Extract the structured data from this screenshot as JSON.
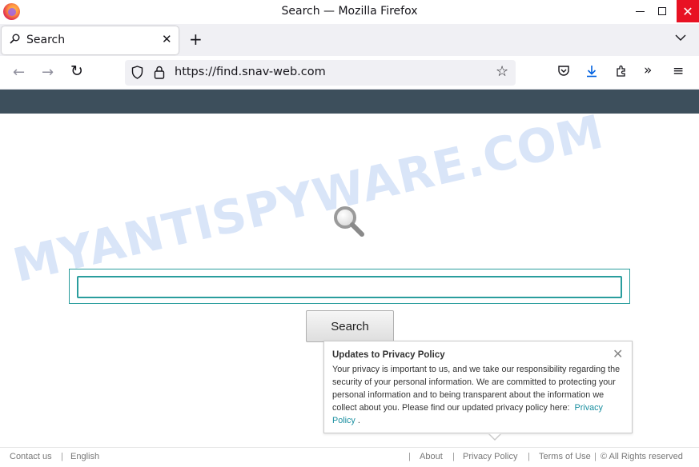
{
  "window": {
    "title": "Search — Mozilla Firefox",
    "minimize_icon": "minimize-icon",
    "maximize_icon": "maximize-icon",
    "close_glyph": "✕"
  },
  "tabs": [
    {
      "label": "Search",
      "icon": "search-icon",
      "close_glyph": "✕"
    }
  ],
  "tabstrip": {
    "new_tab_glyph": "+",
    "list_glyph": "⌵"
  },
  "navbar": {
    "back_glyph": "←",
    "forward_glyph": "→",
    "reload_glyph": "↻",
    "url": "https://find.snav-web.com",
    "star_glyph": "☆",
    "more_glyph": "»",
    "menu_glyph": "≡",
    "pocket_glyph": "⌵",
    "download_glyph": "⤓",
    "extensions_glyph": "⧉"
  },
  "page": {
    "watermark": "MYANTISPYWARE.COM",
    "search": {
      "value": "",
      "button_label": "Search"
    },
    "popup": {
      "title": "Updates to Privacy Policy",
      "body": "Your privacy is important to us, and we take our responsibility regarding the security of your personal information. We are committed to protecting your personal information and to being transparent about the information we collect about you. Please find our updated privacy policy here:",
      "link_label": "Privacy Policy",
      "trailing": ".",
      "close_glyph": "✕"
    },
    "footer": {
      "contact": "Contact us",
      "language": "English",
      "about": "About",
      "privacy": "Privacy Policy",
      "terms": "Terms of Use",
      "copyright": "© All Rights reserved",
      "separator": "|"
    }
  },
  "colors": {
    "accent_teal": "#2a9d9d",
    "topbar": "#3d4f5c",
    "close_red": "#e81123",
    "download_blue": "#0061e0"
  }
}
